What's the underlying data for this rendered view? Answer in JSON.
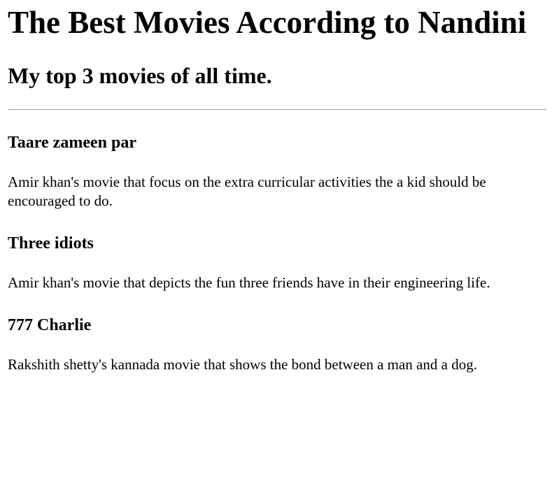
{
  "page": {
    "title": "The Best Movies According to Nandini",
    "subtitle": "My top 3 movies of all time."
  },
  "movies": [
    {
      "title": "Taare zameen par",
      "description": "Amir khan's movie that focus on the extra curricular activities the a kid should be encouraged to do."
    },
    {
      "title": "Three idiots",
      "description": "Amir khan's movie that depicts the fun three friends have in their engineering life."
    },
    {
      "title": "777 Charlie",
      "description": "Rakshith shetty's kannada movie that shows the bond between a man and a dog."
    }
  ]
}
